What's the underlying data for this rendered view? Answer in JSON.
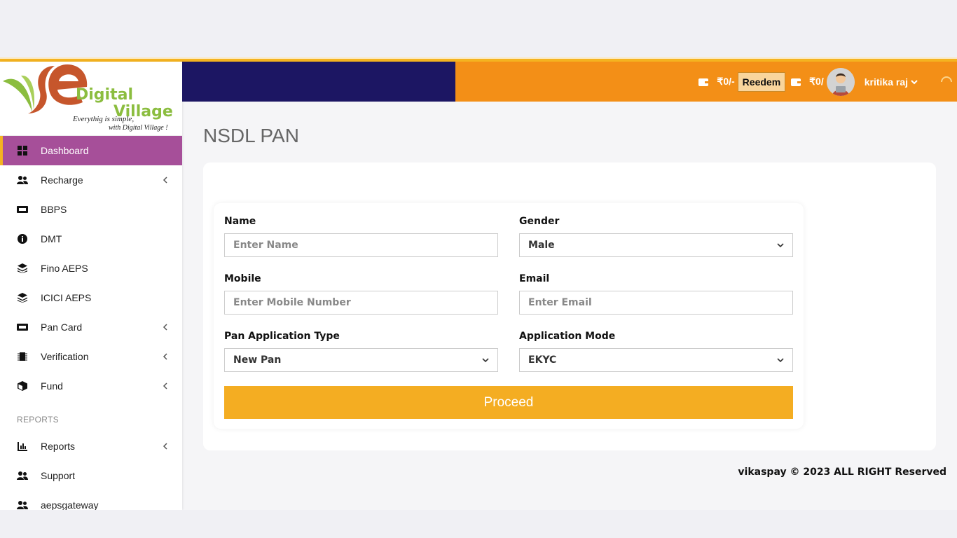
{
  "brand": {
    "logo_word1": "Digital",
    "logo_word2": "Village",
    "tagline_line1": "Everythig is simple,",
    "tagline_line2": "with Digital Village !"
  },
  "sidebar": {
    "items": [
      {
        "label": "Dashboard",
        "icon": "dashboard-icon",
        "active": true
      },
      {
        "label": "Recharge",
        "icon": "users-icon",
        "has_submenu": true
      },
      {
        "label": "BBPS",
        "icon": "ticket-icon"
      },
      {
        "label": "DMT",
        "icon": "info-icon"
      },
      {
        "label": "Fino AEPS",
        "icon": "layers-icon"
      },
      {
        "label": "ICICI AEPS",
        "icon": "layers-icon"
      },
      {
        "label": "Pan Card",
        "icon": "ticket-icon",
        "has_submenu": true
      },
      {
        "label": "Verification",
        "icon": "chip-icon",
        "has_submenu": true
      },
      {
        "label": "Fund",
        "icon": "box-icon",
        "has_submenu": true
      }
    ],
    "section_reports": "REPORTS",
    "report_items": [
      {
        "label": "Reports",
        "icon": "bar-chart-icon",
        "has_submenu": true
      },
      {
        "label": "Support",
        "icon": "users-icon"
      },
      {
        "label": "aepsgateway",
        "icon": "users-icon"
      }
    ]
  },
  "header": {
    "balance_main": "₹0/-",
    "redeem_label": "Reedem",
    "balance_aeps": "₹0/",
    "user_name": "kritika raj",
    "colors": {
      "left": "#1c1663",
      "right": "#f38f17",
      "accent": "#f4b320"
    }
  },
  "main": {
    "page_title": "NSDL PAN",
    "form": {
      "name_label": "Name",
      "name_placeholder": "Enter Name",
      "gender_label": "Gender",
      "gender_value": "Male",
      "mobile_label": "Mobile",
      "mobile_placeholder": "Enter Mobile Number",
      "email_label": "Email",
      "email_placeholder": "Enter Email",
      "pan_type_label": "Pan Application Type",
      "pan_type_value": "New Pan",
      "mode_label": "Application Mode",
      "mode_value": "EKYC",
      "proceed_label": "Proceed"
    }
  },
  "footer": {
    "text": "vikaspay © 2023 ALL RIGHT Reserved"
  }
}
